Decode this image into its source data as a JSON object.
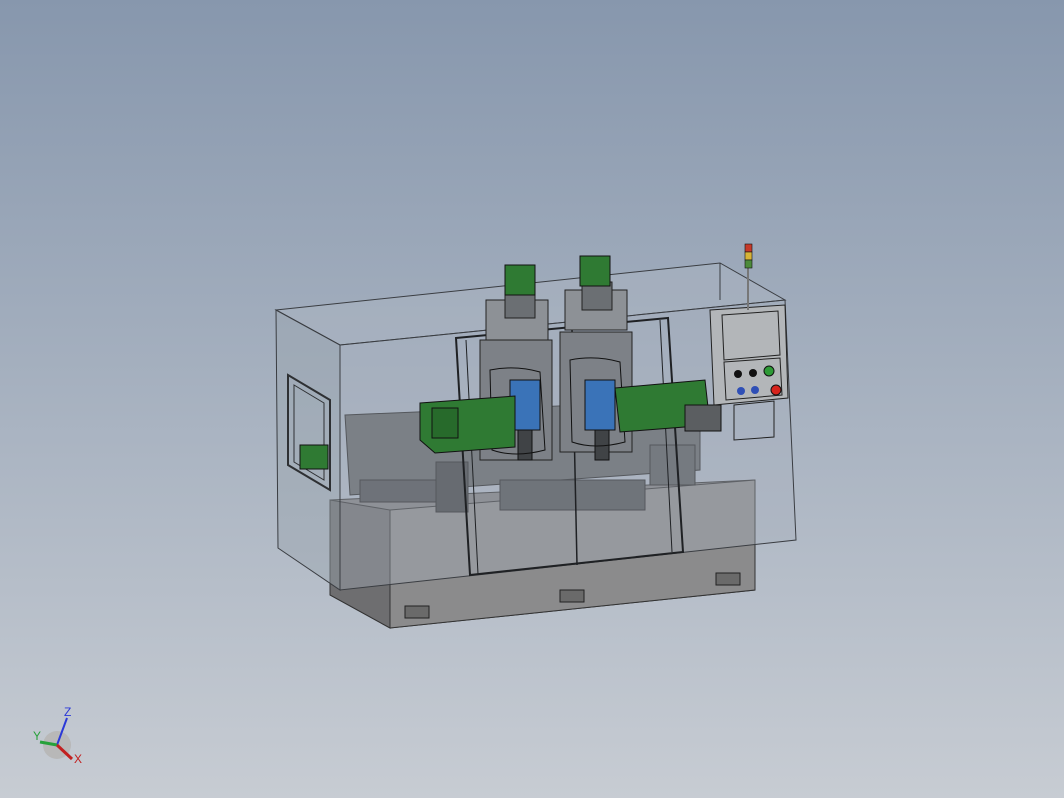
{
  "viewport": {
    "background_top": "#8797ad",
    "background_bottom": "#c7ccd3"
  },
  "model": {
    "base_color": "#8b8b8b",
    "enclosure_glass_color": "#a9b3bf",
    "spindle_green": "#2f7a33",
    "bracket_blue": "#3a73b8",
    "panel_color": "#b3b6b9",
    "control_buttons": [
      {
        "name": "black-button-1",
        "color": "#111111"
      },
      {
        "name": "black-button-2",
        "color": "#111111"
      },
      {
        "name": "green-button",
        "color": "#2e9a36"
      },
      {
        "name": "blue-button-1",
        "color": "#2f4fb6"
      },
      {
        "name": "blue-button-2",
        "color": "#2f4fb6"
      },
      {
        "name": "red-button",
        "color": "#d6231c"
      }
    ],
    "stack_light_colors": [
      "#c63a2a",
      "#d7b338",
      "#4c8a3a"
    ]
  },
  "triad": {
    "z_label": "Z",
    "y_label": "Y",
    "x_label": "X",
    "z_color": "#2b39d8",
    "y_color": "#27a13a",
    "x_color": "#c22020"
  }
}
